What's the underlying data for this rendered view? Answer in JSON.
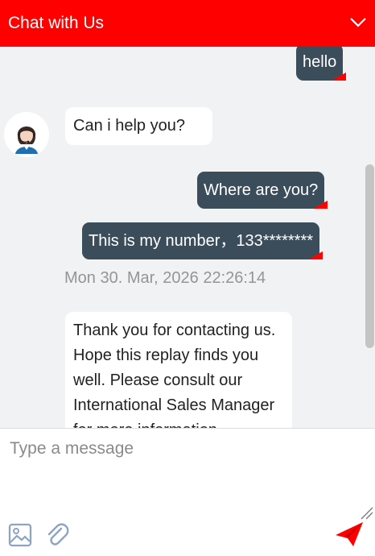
{
  "header": {
    "title": "Chat with Us",
    "collapse_icon": "chevron-down-icon",
    "color": "#ff0000"
  },
  "messages": [
    {
      "from": "user",
      "text": "hello"
    },
    {
      "from": "agent",
      "text": "Can i help you?"
    },
    {
      "from": "user",
      "text": "Where are you?"
    },
    {
      "from": "user",
      "text": "This is my number，133********"
    },
    {
      "timestamp": "Mon 30. Mar, 2026 22:26:14"
    },
    {
      "from": "agent",
      "text": "Thank you for contacting us. Hope this replay finds you well. Please consult our International Sales Manager for more information."
    }
  ],
  "composer": {
    "placeholder": "Type a message",
    "image_icon": "image-icon",
    "attach_icon": "paperclip-icon",
    "send_icon": "paper-plane-send-icon"
  },
  "colors": {
    "accent": "#ff0000",
    "user_bubble": "#3b4d5a",
    "background": "#f1f2f3"
  }
}
